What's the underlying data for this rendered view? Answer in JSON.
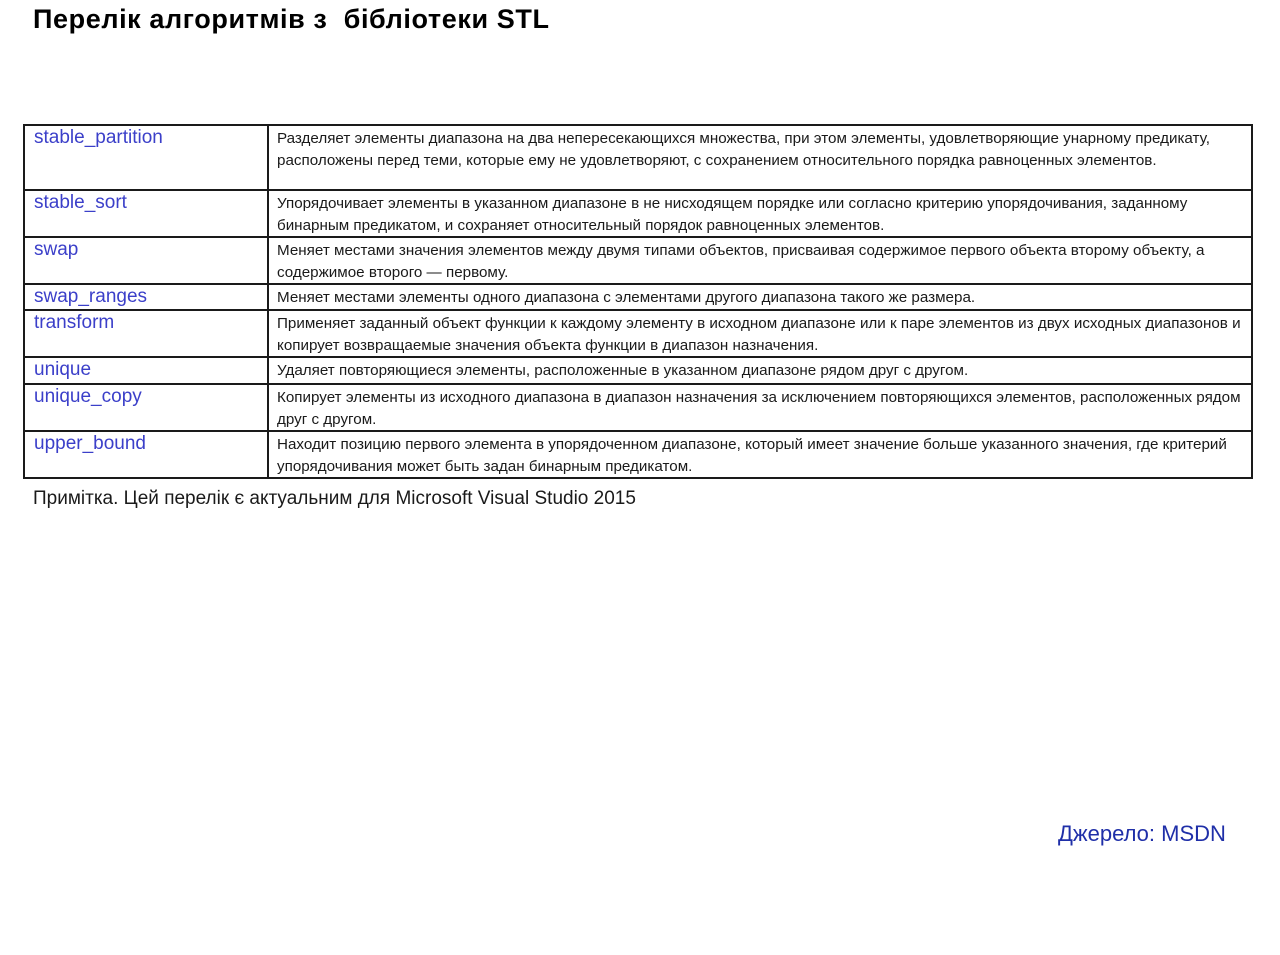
{
  "title": "Перелік алгоритмів з  бібліотеки STL",
  "table": {
    "rows": [
      {
        "name": "stable_partition",
        "description": "Разделяет элементы диапазона на два непересекающихся множества, при этом элементы, удовлетворяющие унарному предикату, расположены перед теми, которые ему не удовлетворяют, с сохранением относительного порядка равноценных элементов."
      },
      {
        "name": "stable_sort",
        "description": "Упорядочивает элементы в указанном диапазоне в не нисходящем порядке или согласно критерию упорядочивания, заданному бинарным предикатом, и сохраняет относительный порядок равноценных элементов."
      },
      {
        "name": "swap",
        "description": "Меняет местами значения элементов между двумя типами объектов, присваивая содержимое первого объекта второму объекту, а содержимое второго — первому."
      },
      {
        "name": "swap_ranges",
        "description": "Меняет местами элементы одного диапазона с элементами другого диапазона такого же размера."
      },
      {
        "name": "transform",
        "description": "Применяет заданный объект функции к каждому элементу в исходном диапазоне или к паре элементов из двух исходных диапазонов и копирует возвращаемые значения объекта функции в диапазон назначения."
      },
      {
        "name": "unique",
        "description": "Удаляет повторяющиеся элементы, расположенные в указанном диапазоне рядом друг с другом."
      },
      {
        "name": "unique_copy",
        "description": "Копирует элементы из исходного диапазона в диапазон назначения за исключением повторяющихся элементов, расположенных рядом друг с другом."
      },
      {
        "name": "upper_bound",
        "description": "Находит позицию первого элемента в упорядоченном диапазоне, который имеет значение больше указанного значения, где критерий упорядочивания может быть задан бинарным предикатом."
      }
    ]
  },
  "note": "Примітка. Цей перелік є актуальним для Microsoft Visual Studio 2015",
  "source": "Джерело: MSDN",
  "colors": {
    "name_text": "#3b3fc9",
    "source_text": "#1f2fa8",
    "border": "#1a1a1a"
  }
}
